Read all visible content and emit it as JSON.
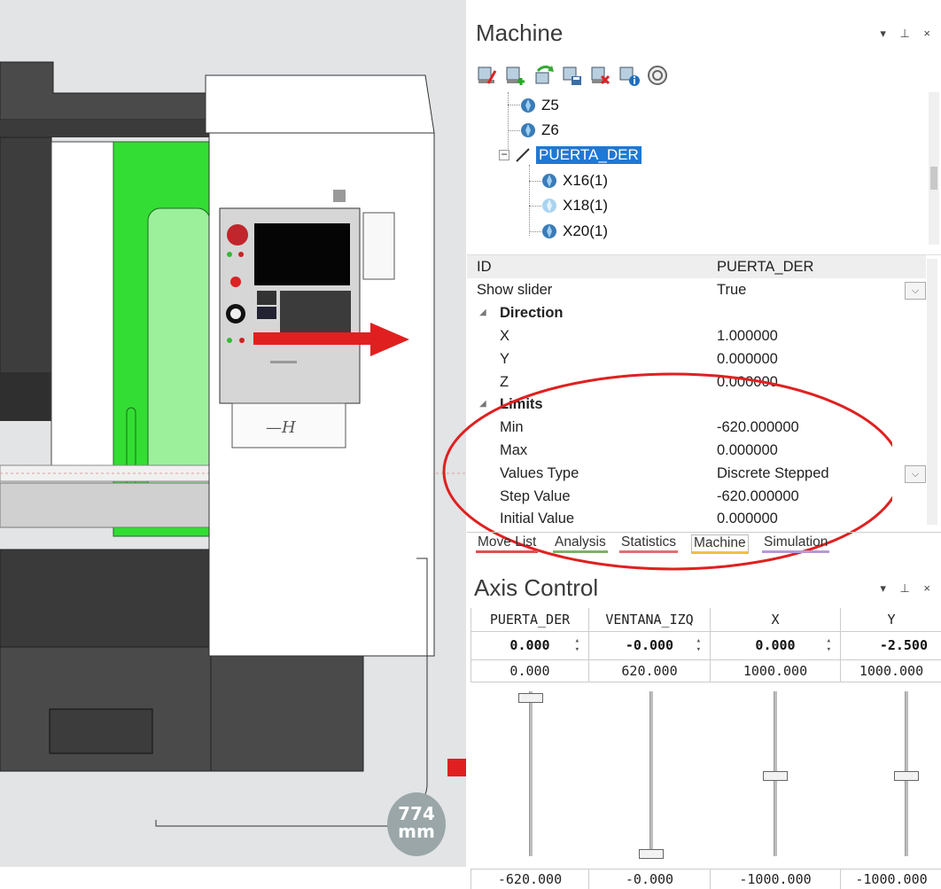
{
  "viewport": {
    "measurement": {
      "value": "774",
      "unit": "mm"
    }
  },
  "machine_panel": {
    "title": "Machine",
    "window_controls": "▾ ⊥ ×",
    "toolbar": [
      "edit-machine-icon",
      "add-component-icon",
      "refresh-icon",
      "save-icon",
      "delete-icon",
      "info-icon",
      "search-icon"
    ],
    "tree": [
      {
        "label": "Z5",
        "selected": false
      },
      {
        "label": "Z6",
        "selected": false
      },
      {
        "label": "PUERTA_DER",
        "selected": true
      },
      {
        "label": "X16(1)",
        "selected": false
      },
      {
        "label": "X18(1)",
        "selected": false
      },
      {
        "label": "X20(1)",
        "selected": false
      }
    ],
    "properties": {
      "id": {
        "label": "ID",
        "value": "PUERTA_DER"
      },
      "show_slider": {
        "label": "Show slider",
        "value": "True"
      },
      "direction": {
        "label": "Direction",
        "x": {
          "label": "X",
          "value": "1.000000"
        },
        "y": {
          "label": "Y",
          "value": "0.000000"
        },
        "z": {
          "label": "Z",
          "value": "0.000000"
        }
      },
      "limits": {
        "label": "Limits",
        "min": {
          "label": "Min",
          "value": "-620.000000"
        },
        "max": {
          "label": "Max",
          "value": "0.000000"
        },
        "values_type": {
          "label": "Values Type",
          "value": "Discrete Stepped"
        },
        "step_value": {
          "label": "Step Value",
          "value": "-620.000000"
        },
        "initial_value": {
          "label": "Initial Value",
          "value": "0.000000"
        }
      }
    },
    "tabs": [
      {
        "label": "Move List",
        "color": "#e05050"
      },
      {
        "label": "Analysis",
        "color": "#7fb06a"
      },
      {
        "label": "Statistics",
        "color": "#e07070"
      },
      {
        "label": "Machine",
        "color": "#f0c040",
        "active": true
      },
      {
        "label": "Simulation",
        "color": "#b59ad6"
      }
    ]
  },
  "axis_control": {
    "title": "Axis Control",
    "window_controls": "▾ ⊥ ×",
    "columns": [
      {
        "name": "PUERTA_DER",
        "current": "0.000",
        "max": "0.000",
        "min": "-620.000",
        "position": 1.0
      },
      {
        "name": "VENTANA_IZQ",
        "current": "-0.000",
        "max": "620.000",
        "min": "-0.000",
        "position": 0.0
      },
      {
        "name": "X",
        "current": "0.000",
        "max": "1000.000",
        "min": "-1000.000",
        "position": 0.5
      },
      {
        "name": "Y",
        "current": "-2.500",
        "max": "1000.000",
        "min": "-1000.000",
        "position": 0.5
      }
    ]
  },
  "colors": {
    "highlight": "#e02020",
    "selection": "#1e78d6",
    "door_green": "#33dd33"
  }
}
